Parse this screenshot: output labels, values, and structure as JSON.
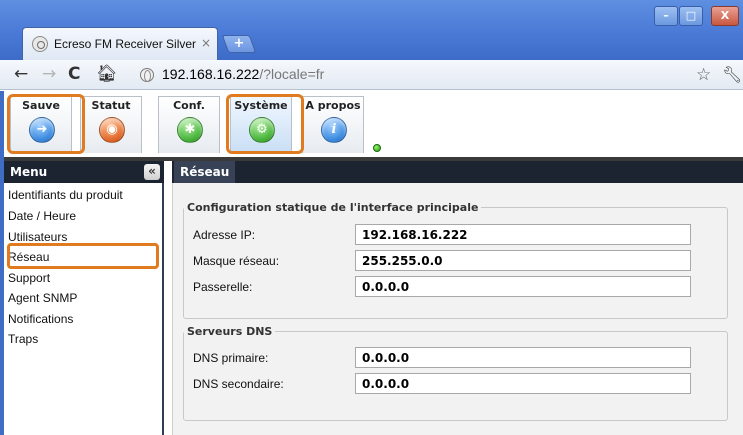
{
  "browser": {
    "tab_title": "Ecreso FM Receiver Silver",
    "tab_close": "×",
    "new_tab": "+",
    "url_host": "192.168.16.222",
    "url_rest": "/?locale=fr",
    "icons": {
      "back": "←",
      "forward": "→",
      "reload": "C",
      "home": "🏠︎",
      "bookmark": "☆",
      "wrench": "🔧︎"
    },
    "window_controls": {
      "minimize": "–",
      "maximize": "□",
      "close": "X"
    }
  },
  "app": {
    "nav": [
      {
        "label": "Sauve",
        "icon": "arrow-icon",
        "color": "#3c8be0",
        "glyph": "➔",
        "selected": false,
        "highlighted": true
      },
      {
        "label": "Statut",
        "icon": "rss-icon",
        "color": "#e2692b",
        "glyph": "◉",
        "selected": false,
        "highlighted": false
      },
      {
        "label": "Conf.",
        "icon": "asterisk-icon",
        "color": "#47b43a",
        "glyph": "✱",
        "selected": false,
        "highlighted": false
      },
      {
        "label": "Système",
        "icon": "gear-icon",
        "color": "#47b43a",
        "glyph": "⚙",
        "selected": true,
        "highlighted": true
      },
      {
        "label": "A propos",
        "icon": "info-icon",
        "color": "#3c8be0",
        "glyph": "i",
        "selected": false,
        "highlighted": false
      }
    ],
    "status_led_color": "#2ec21a",
    "highlight_color": "#e07b20",
    "menu": {
      "title": "Menu",
      "collapse_glyph": "«",
      "items": [
        "Identifiants du produit",
        "Date / Heure",
        "Utilisateurs",
        "Réseau",
        "Support",
        "Agent SNMP",
        "Notifications",
        "Traps"
      ],
      "selected_item": "Réseau"
    },
    "panel": {
      "tab": "Réseau",
      "interface": {
        "legend": "Configuration statique de l'interface principale",
        "ip_label": "Adresse IP:",
        "ip_value": "192.168.16.222",
        "mask_label": "Masque réseau:",
        "mask_value": "255.255.0.0",
        "gateway_label": "Passerelle:",
        "gateway_value": "0.0.0.0"
      },
      "dns": {
        "legend": "Serveurs DNS",
        "primary_label": "DNS primaire:",
        "primary_value": "0.0.0.0",
        "secondary_label": "DNS secondaire:",
        "secondary_value": "0.0.0.0"
      }
    }
  }
}
